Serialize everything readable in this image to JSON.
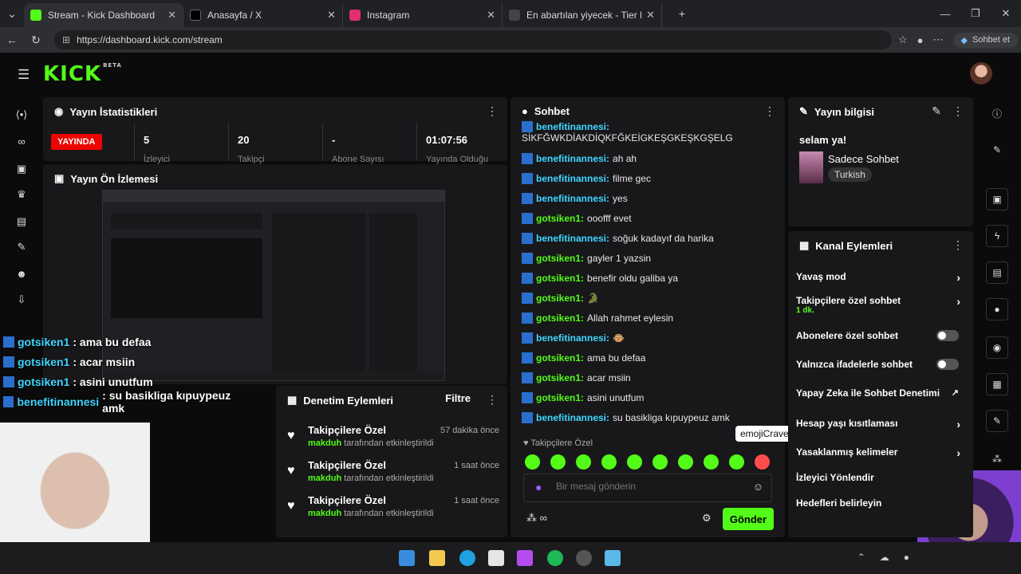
{
  "browser": {
    "tabs": [
      {
        "title": "Stream - Kick Dashboard",
        "favicon_color": "#53fc18"
      },
      {
        "title": "Anasayfa / X",
        "favicon_color": "#000000"
      },
      {
        "title": "Instagram",
        "favicon_color": "#e1306c"
      },
      {
        "title": "En abartılan yiyecek - Tier List, Kor",
        "favicon_color": "#444444"
      }
    ],
    "url": "https://dashboard.kick.com/stream",
    "copilot_label": "Sohbet et"
  },
  "kick": {
    "logo": "KICK",
    "logo_sup": "BETA"
  },
  "stats": {
    "title": "Yayın İstatistikleri",
    "live_label": "YAYINDA",
    "values": [
      "5",
      "20",
      "-",
      "01:07:56"
    ],
    "labels": [
      "İzleyici",
      "Takipçi",
      "Abone Sayısı",
      "Yayında Olduğu"
    ]
  },
  "preview": {
    "title": "Yayın Ön İzlemesi"
  },
  "overlay_chat": [
    {
      "user": "gotsiken1",
      "text": ": ama bu defaa"
    },
    {
      "user": "gotsiken1",
      "text": ": acar msiin"
    },
    {
      "user": "gotsiken1",
      "text": ": asini unutfum"
    },
    {
      "user": "benefitinannesi",
      "text": ": su basikliga kıpuypeuz amk"
    }
  ],
  "audit": {
    "title": "Denetim Eylemleri",
    "filter": "Filtre",
    "items": [
      {
        "title": "Takipçilere Özel",
        "by": "makduh",
        "suffix": "tarafından etkinleştirildi",
        "time": "57 dakika önce"
      },
      {
        "title": "Takipçilere Özel",
        "by": "makduh",
        "suffix": "tarafından etkinleştirildi",
        "time": "1 saat önce"
      },
      {
        "title": "Takipçilere Özel",
        "by": "makduh",
        "suffix": "tarafından etkinleştirildi",
        "time": "1 saat önce"
      }
    ]
  },
  "chat": {
    "title": "Sohbet",
    "messages": [
      {
        "user": "benefitinannesi:",
        "text": "SİKFĞWKDİAKDİQKFĞKEİGKEŞGKEŞKGŞELG",
        "green": false
      },
      {
        "user": "benefitinannesi:",
        "text": "ah ah",
        "green": false
      },
      {
        "user": "benefitinannesi:",
        "text": "filme gec",
        "green": false
      },
      {
        "user": "benefitinannesi:",
        "text": "yes",
        "green": false
      },
      {
        "user": "gotsiken1:",
        "text": "ooofff evet",
        "green": true
      },
      {
        "user": "benefitinannesi:",
        "text": "soğuk kadayıf da harika",
        "green": false
      },
      {
        "user": "gotsiken1:",
        "text": "gayler 1 yazsin",
        "green": true
      },
      {
        "user": "gotsiken1:",
        "text": "benefir oldu galiba ya",
        "green": true
      },
      {
        "user": "gotsiken1:",
        "text": "🐊",
        "green": true
      },
      {
        "user": "gotsiken1:",
        "text": "Allah rahmet eylesin",
        "green": true
      },
      {
        "user": "benefitinannesi:",
        "text": "🐵",
        "green": false
      },
      {
        "user": "gotsiken1:",
        "text": "ama bu defaa",
        "green": true
      },
      {
        "user": "gotsiken1:",
        "text": "acar msiin",
        "green": true
      },
      {
        "user": "gotsiken1:",
        "text": "asini unutfum",
        "green": true
      },
      {
        "user": "benefitinannesi:",
        "text": "su basikliga kıpuypeuz amk",
        "green": false
      }
    ],
    "mode_tag": "Takipçilere Özel",
    "tooltip": "emojiCrave",
    "input_placeholder": "Bir mesaj gönderin",
    "points": "∞",
    "send_label": "Gönder"
  },
  "info": {
    "title": "Yayın bilgisi",
    "stream_title": "selam ya!",
    "category": "Sadece Sohbet",
    "language": "Turkish"
  },
  "actions": {
    "title": "Kanal Eylemleri",
    "items": [
      {
        "label": "Yavaş mod",
        "sub": "",
        "control": "chevron"
      },
      {
        "label": "Takipçilere özel sohbet",
        "sub": "1 dk.",
        "control": "chevron"
      },
      {
        "label": "Abonelere özel sohbet",
        "sub": "",
        "control": "toggle"
      },
      {
        "label": "Yalnızca ifadelerle sohbet",
        "sub": "",
        "control": "toggle"
      },
      {
        "label": "Yapay Zeka ile Sohbet Denetimi",
        "sub": "",
        "control": "external"
      },
      {
        "label": "Hesap yaşı kısıtlaması",
        "sub": "",
        "control": "chevron"
      },
      {
        "label": "Yasaklanmış kelimeler",
        "sub": "",
        "control": "chevron"
      },
      {
        "label": "İzleyici Yönlendir",
        "sub": "",
        "control": "none"
      },
      {
        "label": "Hedefleri belirleyin",
        "sub": "",
        "control": "none"
      }
    ]
  }
}
